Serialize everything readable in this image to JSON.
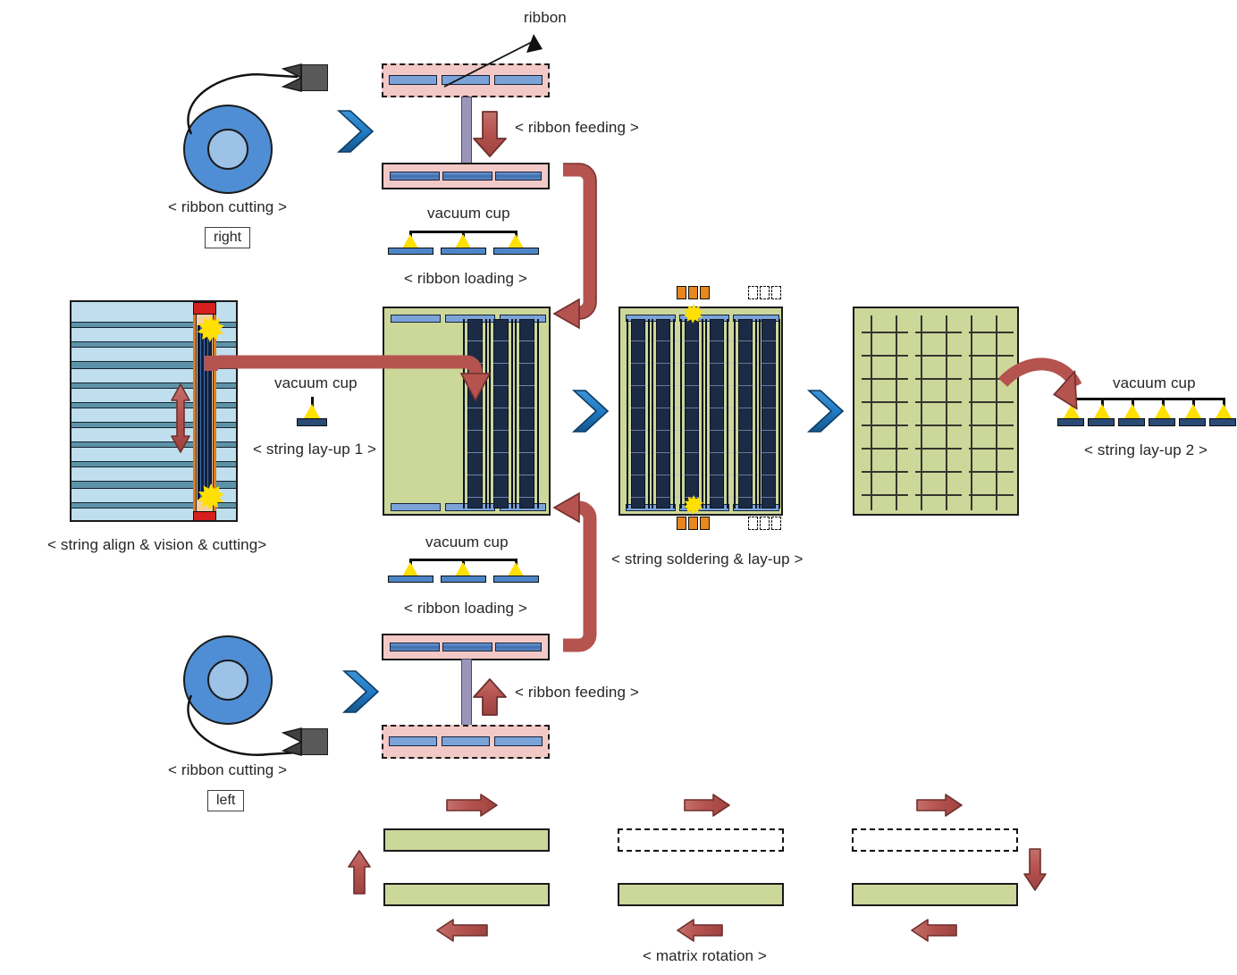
{
  "diagram": {
    "title_hidden": "",
    "labels": {
      "ribbon": "ribbon",
      "ribbon_feeding": "< ribbon feeding >",
      "ribbon_cutting": "< ribbon cutting >",
      "ribbon_loading": "< ribbon loading >",
      "vacuum_cup": "vacuum cup",
      "right": "right",
      "left": "left",
      "string_align": "< string align & vision & cutting>",
      "string_layup_1": "< string lay-up 1 >",
      "string_soldering": "< string soldering  & lay-up >",
      "string_layup_2": "< string lay-up 2 >",
      "matrix_rotation": "< matrix rotation >"
    },
    "stations": [
      {
        "id": "ribbon-cutting-right",
        "label": "< ribbon cutting >",
        "tag": "right"
      },
      {
        "id": "ribbon-feeding-top",
        "label": "< ribbon feeding >"
      },
      {
        "id": "ribbon-loading-top",
        "label": "< ribbon loading >",
        "tool": "vacuum cup"
      },
      {
        "id": "string-align-vision-cutting",
        "label": "< string align & vision & cutting>"
      },
      {
        "id": "string-layup-1",
        "label": "< string lay-up 1 >",
        "tool": "vacuum cup"
      },
      {
        "id": "string-soldering-layup",
        "label": "< string soldering  & lay-up >"
      },
      {
        "id": "string-layup-2",
        "label": "< string lay-up 2 >",
        "tool": "vacuum cup"
      },
      {
        "id": "ribbon-loading-bottom",
        "label": "< ribbon loading >",
        "tool": "vacuum cup"
      },
      {
        "id": "ribbon-feeding-bottom",
        "label": "< ribbon feeding >"
      },
      {
        "id": "ribbon-cutting-left",
        "label": "< ribbon cutting >",
        "tag": "left"
      },
      {
        "id": "matrix-rotation",
        "label": "< matrix rotation >"
      }
    ],
    "colors": {
      "tray": "#f2c9c6",
      "ribbon": "#4e85c7",
      "panel_green": "#ccd79a",
      "cell_dark": "#1b2a45",
      "align_blue": "#bfdfee",
      "arrow_red": "#b5534f",
      "chevron_blue": "#1f78c1",
      "vacuum_yellow": "#ffe000",
      "solder_orange": "#e8861f",
      "spool_blue": "#4f8ed4",
      "cutter_grey": "#595959"
    },
    "counts": {
      "ribbons_per_tray": 3,
      "vacuum_cups_loading": 3,
      "vacuum_cups_layup1": 1,
      "vacuum_cups_layup2": 6,
      "string_groups_layup1": 3,
      "string_groups_soldering": 3,
      "solder_chips": 3
    }
  }
}
